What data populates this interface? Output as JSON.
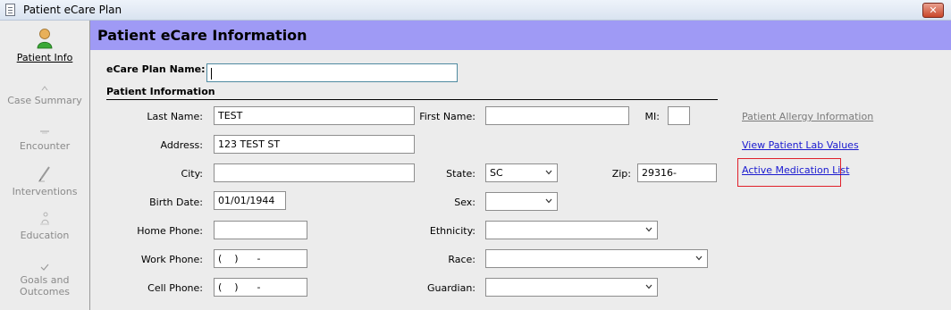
{
  "window": {
    "title": "Patient eCare Plan",
    "close_glyph": "✕"
  },
  "sidebar": {
    "items": [
      {
        "label": "Patient Info",
        "icon": "person-icon",
        "active": true
      },
      {
        "label": "Case Summary",
        "icon": "case-summary-icon",
        "active": false
      },
      {
        "label": "Encounter",
        "icon": "encounter-icon",
        "active": false
      },
      {
        "label": "Interventions",
        "icon": "pen-icon",
        "active": false
      },
      {
        "label": "Education",
        "icon": "education-icon",
        "active": false
      },
      {
        "label": "Goals and",
        "label2": "Outcomes",
        "icon": "checkmark-icon",
        "active": false
      }
    ]
  },
  "header": {
    "title": "Patient eCare Information"
  },
  "form": {
    "plan_name_label": "eCare Plan Name:",
    "plan_name_value": "",
    "section_label": "Patient Information",
    "last_name_label": "Last Name:",
    "last_name_value": "TEST",
    "first_name_label": "First Name:",
    "first_name_value": "",
    "mi_label": "MI:",
    "mi_value": "",
    "address_label": "Address:",
    "address_value": "123 TEST ST",
    "city_label": "City:",
    "city_value": "",
    "state_label": "State:",
    "state_value": "SC",
    "zip_label": "Zip:",
    "zip_value": "29316-",
    "birth_date_label": "Birth Date:",
    "birth_date_value": "01/01/1944",
    "sex_label": "Sex:",
    "sex_value": "",
    "home_phone_label": "Home Phone:",
    "home_phone_value": "",
    "ethnicity_label": "Ethnicity:",
    "ethnicity_value": "",
    "work_phone_label": "Work Phone:",
    "work_phone_value": "(    )      -",
    "race_label": "Race:",
    "race_value": "",
    "cell_phone_label": "Cell Phone:",
    "cell_phone_value": "(    )      -",
    "guardian_label": "Guardian:",
    "guardian_value": ""
  },
  "links": {
    "allergy": "Patient Allergy Information",
    "lab_values": "View Patient Lab Values",
    "medications": "Active Medication List"
  },
  "colors": {
    "header_bg": "#9f9af5",
    "link": "#1a1ad0",
    "highlight_border": "#e0202a"
  }
}
